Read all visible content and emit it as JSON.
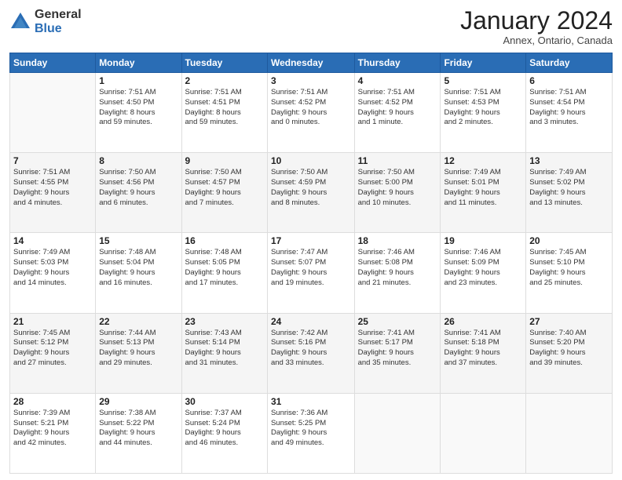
{
  "logo": {
    "general": "General",
    "blue": "Blue"
  },
  "header": {
    "month": "January 2024",
    "location": "Annex, Ontario, Canada"
  },
  "weekdays": [
    "Sunday",
    "Monday",
    "Tuesday",
    "Wednesday",
    "Thursday",
    "Friday",
    "Saturday"
  ],
  "weeks": [
    [
      {
        "day": "",
        "info": ""
      },
      {
        "day": "1",
        "info": "Sunrise: 7:51 AM\nSunset: 4:50 PM\nDaylight: 8 hours\nand 59 minutes."
      },
      {
        "day": "2",
        "info": "Sunrise: 7:51 AM\nSunset: 4:51 PM\nDaylight: 8 hours\nand 59 minutes."
      },
      {
        "day": "3",
        "info": "Sunrise: 7:51 AM\nSunset: 4:52 PM\nDaylight: 9 hours\nand 0 minutes."
      },
      {
        "day": "4",
        "info": "Sunrise: 7:51 AM\nSunset: 4:52 PM\nDaylight: 9 hours\nand 1 minute."
      },
      {
        "day": "5",
        "info": "Sunrise: 7:51 AM\nSunset: 4:53 PM\nDaylight: 9 hours\nand 2 minutes."
      },
      {
        "day": "6",
        "info": "Sunrise: 7:51 AM\nSunset: 4:54 PM\nDaylight: 9 hours\nand 3 minutes."
      }
    ],
    [
      {
        "day": "7",
        "info": "Sunrise: 7:51 AM\nSunset: 4:55 PM\nDaylight: 9 hours\nand 4 minutes."
      },
      {
        "day": "8",
        "info": "Sunrise: 7:50 AM\nSunset: 4:56 PM\nDaylight: 9 hours\nand 6 minutes."
      },
      {
        "day": "9",
        "info": "Sunrise: 7:50 AM\nSunset: 4:57 PM\nDaylight: 9 hours\nand 7 minutes."
      },
      {
        "day": "10",
        "info": "Sunrise: 7:50 AM\nSunset: 4:59 PM\nDaylight: 9 hours\nand 8 minutes."
      },
      {
        "day": "11",
        "info": "Sunrise: 7:50 AM\nSunset: 5:00 PM\nDaylight: 9 hours\nand 10 minutes."
      },
      {
        "day": "12",
        "info": "Sunrise: 7:49 AM\nSunset: 5:01 PM\nDaylight: 9 hours\nand 11 minutes."
      },
      {
        "day": "13",
        "info": "Sunrise: 7:49 AM\nSunset: 5:02 PM\nDaylight: 9 hours\nand 13 minutes."
      }
    ],
    [
      {
        "day": "14",
        "info": "Sunrise: 7:49 AM\nSunset: 5:03 PM\nDaylight: 9 hours\nand 14 minutes."
      },
      {
        "day": "15",
        "info": "Sunrise: 7:48 AM\nSunset: 5:04 PM\nDaylight: 9 hours\nand 16 minutes."
      },
      {
        "day": "16",
        "info": "Sunrise: 7:48 AM\nSunset: 5:05 PM\nDaylight: 9 hours\nand 17 minutes."
      },
      {
        "day": "17",
        "info": "Sunrise: 7:47 AM\nSunset: 5:07 PM\nDaylight: 9 hours\nand 19 minutes."
      },
      {
        "day": "18",
        "info": "Sunrise: 7:46 AM\nSunset: 5:08 PM\nDaylight: 9 hours\nand 21 minutes."
      },
      {
        "day": "19",
        "info": "Sunrise: 7:46 AM\nSunset: 5:09 PM\nDaylight: 9 hours\nand 23 minutes."
      },
      {
        "day": "20",
        "info": "Sunrise: 7:45 AM\nSunset: 5:10 PM\nDaylight: 9 hours\nand 25 minutes."
      }
    ],
    [
      {
        "day": "21",
        "info": "Sunrise: 7:45 AM\nSunset: 5:12 PM\nDaylight: 9 hours\nand 27 minutes."
      },
      {
        "day": "22",
        "info": "Sunrise: 7:44 AM\nSunset: 5:13 PM\nDaylight: 9 hours\nand 29 minutes."
      },
      {
        "day": "23",
        "info": "Sunrise: 7:43 AM\nSunset: 5:14 PM\nDaylight: 9 hours\nand 31 minutes."
      },
      {
        "day": "24",
        "info": "Sunrise: 7:42 AM\nSunset: 5:16 PM\nDaylight: 9 hours\nand 33 minutes."
      },
      {
        "day": "25",
        "info": "Sunrise: 7:41 AM\nSunset: 5:17 PM\nDaylight: 9 hours\nand 35 minutes."
      },
      {
        "day": "26",
        "info": "Sunrise: 7:41 AM\nSunset: 5:18 PM\nDaylight: 9 hours\nand 37 minutes."
      },
      {
        "day": "27",
        "info": "Sunrise: 7:40 AM\nSunset: 5:20 PM\nDaylight: 9 hours\nand 39 minutes."
      }
    ],
    [
      {
        "day": "28",
        "info": "Sunrise: 7:39 AM\nSunset: 5:21 PM\nDaylight: 9 hours\nand 42 minutes."
      },
      {
        "day": "29",
        "info": "Sunrise: 7:38 AM\nSunset: 5:22 PM\nDaylight: 9 hours\nand 44 minutes."
      },
      {
        "day": "30",
        "info": "Sunrise: 7:37 AM\nSunset: 5:24 PM\nDaylight: 9 hours\nand 46 minutes."
      },
      {
        "day": "31",
        "info": "Sunrise: 7:36 AM\nSunset: 5:25 PM\nDaylight: 9 hours\nand 49 minutes."
      },
      {
        "day": "",
        "info": ""
      },
      {
        "day": "",
        "info": ""
      },
      {
        "day": "",
        "info": ""
      }
    ]
  ]
}
